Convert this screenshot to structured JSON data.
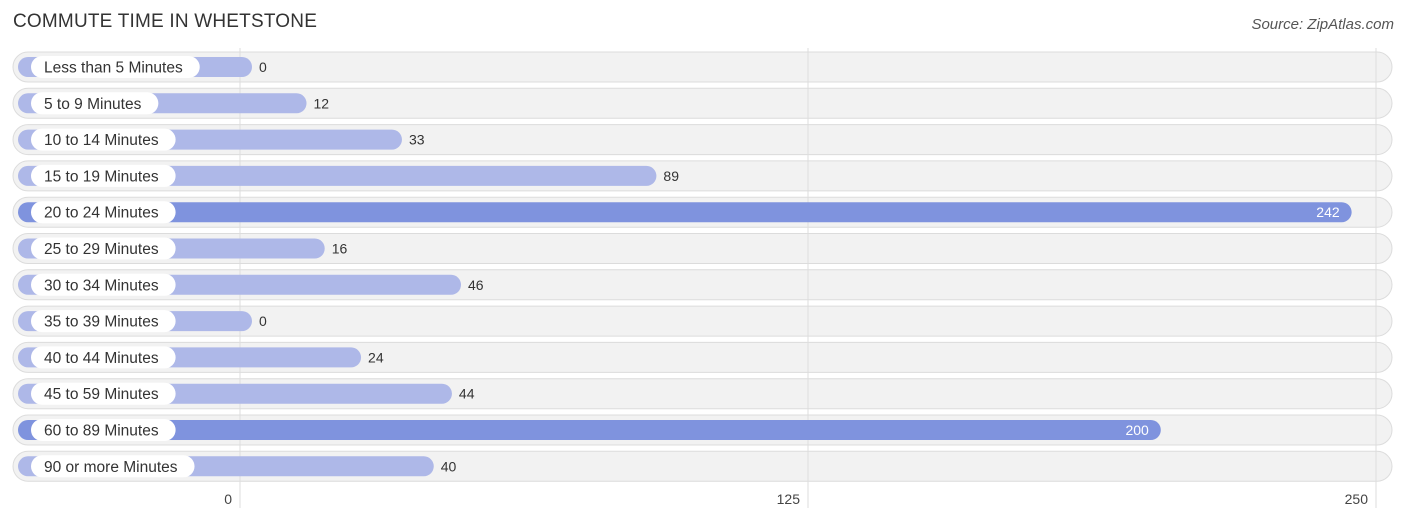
{
  "header": {
    "title": "COMMUTE TIME IN WHETSTONE",
    "source": "Source: ZipAtlas.com"
  },
  "colors": {
    "bar_normal": "#aeb8e8",
    "bar_highlight": "#7f93de",
    "track": "#f2f2f2",
    "grid": "#dddddd"
  },
  "chart_data": {
    "type": "bar",
    "orientation": "horizontal",
    "title": "COMMUTE TIME IN WHETSTONE",
    "xlabel": "",
    "ylabel": "",
    "xlim": [
      0,
      250
    ],
    "xticks": [
      0,
      125,
      250
    ],
    "xtick_labels": [
      "0",
      "125",
      "250"
    ],
    "grid": true,
    "categories": [
      "Less than 5 Minutes",
      "5 to 9 Minutes",
      "10 to 14 Minutes",
      "15 to 19 Minutes",
      "20 to 24 Minutes",
      "25 to 29 Minutes",
      "30 to 34 Minutes",
      "35 to 39 Minutes",
      "40 to 44 Minutes",
      "45 to 59 Minutes",
      "60 to 89 Minutes",
      "90 or more Minutes"
    ],
    "values": [
      0,
      12,
      33,
      89,
      242,
      16,
      46,
      0,
      24,
      44,
      200,
      40
    ],
    "value_labels": [
      "0",
      "12",
      "33",
      "89",
      "242",
      "16",
      "46",
      "0",
      "24",
      "44",
      "200",
      "40"
    ],
    "highlighted": [
      false,
      false,
      false,
      false,
      true,
      false,
      false,
      false,
      false,
      false,
      true,
      false
    ]
  }
}
